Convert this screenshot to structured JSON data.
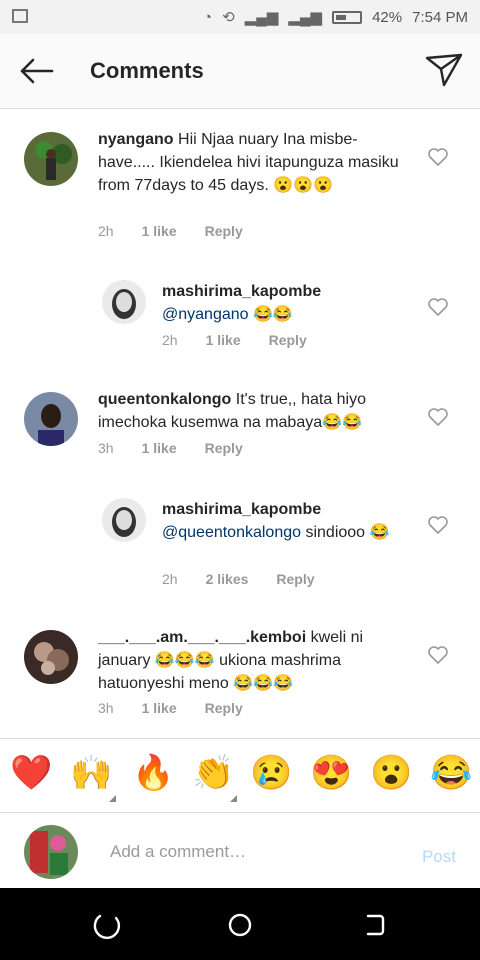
{
  "status_bar": {
    "battery_pct": "42%",
    "time": "7:54 PM"
  },
  "header": {
    "title": "Comments",
    "back_icon": "arrow-left-icon",
    "send_icon": "paper-plane-icon"
  },
  "comments": [
    {
      "username": "nyangano",
      "text": " Hii Njaa nuary Ina misbe-have..... Ikiendelea hivi itapunguza masiku from 77days to 45 days. 😮😮😮",
      "time": "2h",
      "likes": "1 like",
      "reply": "Reply"
    },
    {
      "username": "mashirima_kapombe",
      "mention": "@nyangano",
      "text": " 😂😂",
      "time": "2h",
      "likes": "1 like",
      "reply": "Reply"
    },
    {
      "username": "queentonkalongo",
      "text": " It's true,, hata hiyo imechoka kusemwa na mabaya😂😂",
      "time": "3h",
      "likes": "1 like",
      "reply": "Reply"
    },
    {
      "username": "mashirima_kapombe",
      "mention": "@queentonkalongo",
      "text": " sindiooo 😂",
      "time": "2h",
      "likes": "2 likes",
      "reply": "Reply"
    },
    {
      "username": "___.___.am.___.___.kemboi",
      "text": " kweli ni january 😂😂😂 ukiona mashrima hatuonyeshi meno 😂😂😂",
      "time": "3h",
      "likes": "1 like",
      "reply": "Reply"
    }
  ],
  "emoji_bar": [
    "❤️",
    "🙌",
    "🔥",
    "👏",
    "😢",
    "😍",
    "😮",
    "😂"
  ],
  "composer": {
    "placeholder": "Add a comment…",
    "post_label": "Post"
  },
  "colors": {
    "mention": "#003569",
    "post_disabled": "#b6dafb",
    "meta": "#999999"
  }
}
